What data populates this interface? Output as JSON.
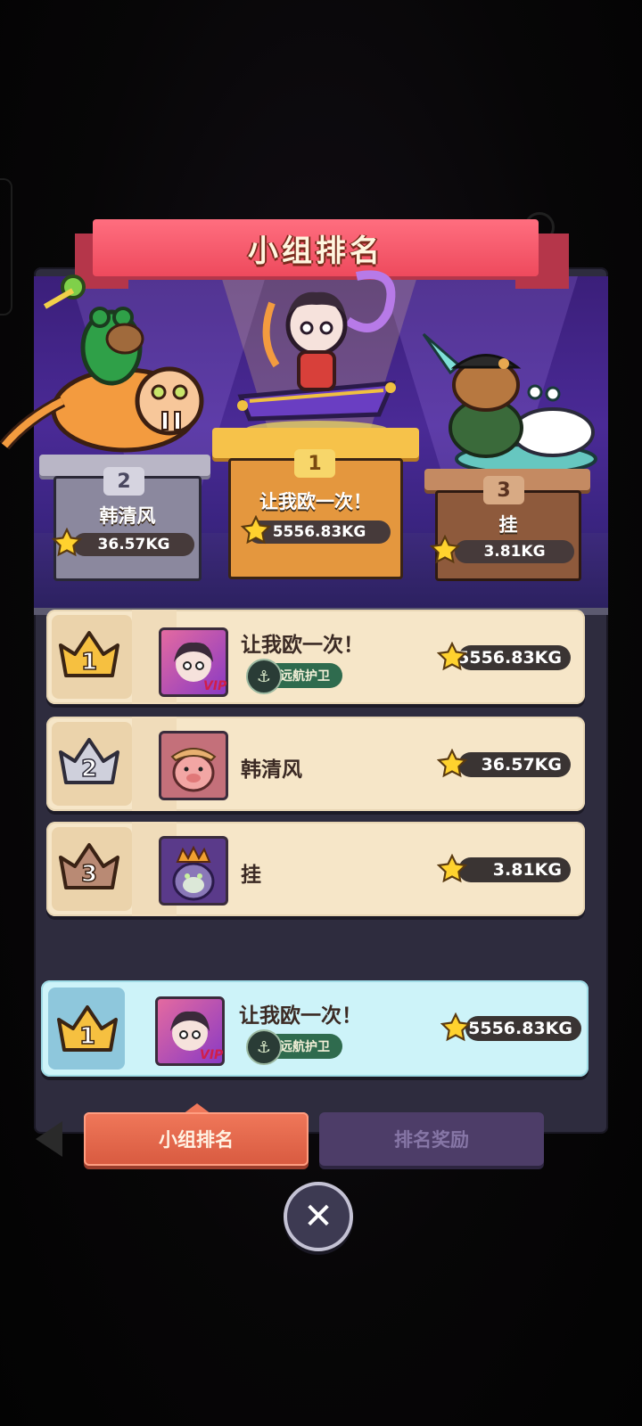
{
  "header": {
    "title": "小组排名"
  },
  "podium": [
    {
      "rank": "1",
      "name": "让我欧一次！",
      "score": "5556.83KG"
    },
    {
      "rank": "2",
      "name": "韩清风",
      "score": "36.57KG"
    },
    {
      "rank": "3",
      "name": "挂",
      "score": "3.81KG"
    }
  ],
  "rankings": [
    {
      "rank": "1",
      "name": "让我欧一次！",
      "guild": "远航护卫",
      "vip": "VIP",
      "score": "5556.83KG"
    },
    {
      "rank": "2",
      "name": "韩清风",
      "score": "36.57KG"
    },
    {
      "rank": "3",
      "name": "挂",
      "score": "3.81KG"
    }
  ],
  "my_rank": {
    "rank": "1",
    "name": "让我欧一次！",
    "guild": "远航护卫",
    "vip": "VIP",
    "score": "5556.83KG"
  },
  "tabs": {
    "group_ranking": "小组排名",
    "ranking_rewards": "排名奖励"
  },
  "icons": {
    "close": "close-icon",
    "star": "star-icon",
    "crown": "crown-icon",
    "back": "back-arrow-icon"
  },
  "colors": {
    "ribbon": "#ee4a5d",
    "active_tab": "#d85a40",
    "inactive_tab": "#4d3d68",
    "row_bg": "#f6e6c8",
    "my_row_bg": "#cdf3f9"
  }
}
